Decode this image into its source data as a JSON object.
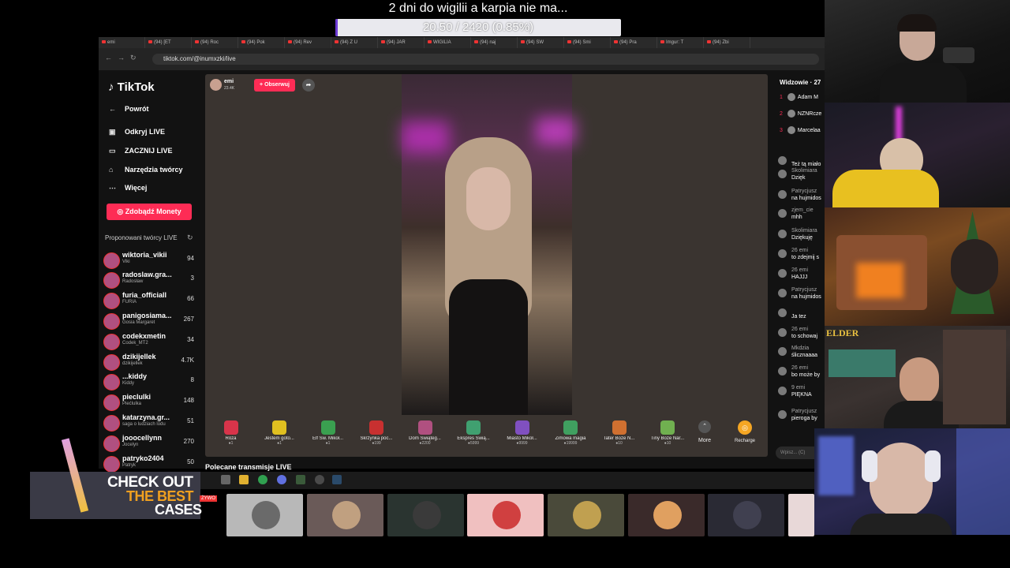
{
  "overlay": {
    "title": "2 dni do wigilii a karpia nie ma...",
    "goal_text": "20.50 / 2420 (0.85%)",
    "goal_progress": 0.0085,
    "goal_fill_color": "#6d3bd6"
  },
  "browser": {
    "tabs": [
      "emi",
      "(94) [ET",
      "(94) Roc",
      "(94) Pok",
      "(94) Rev",
      "(94) Z U",
      "(94) JAR",
      "WIGILIA",
      "(94) naj",
      "(94) SW",
      "(94) Smi",
      "(94) Pra",
      "Imgur: T",
      "(94) Zbi"
    ],
    "nav_icons": [
      "back-icon",
      "forward-icon",
      "reload-icon"
    ],
    "url": "tiktok.com/@inumxzki/live"
  },
  "sidebar": {
    "logo": "TikTok",
    "back": "Powrót",
    "items": [
      {
        "label": "Odkryj LIVE",
        "icon": "calendar-icon"
      },
      {
        "label": "ZACZNIJ LIVE",
        "icon": "video-icon"
      },
      {
        "label": "Narzędzia twórcy",
        "icon": "home-icon"
      },
      {
        "label": "Więcej",
        "icon": "dots-icon"
      }
    ],
    "coins_button": "Zdobądź Monety",
    "suggested_title": "Proponowani twórcy LIVE",
    "creators": [
      {
        "name": "wiktoria_vikii",
        "sub": "Viki",
        "count": "94"
      },
      {
        "name": "radoslaw.gra...",
        "sub": "Radosław",
        "count": "3"
      },
      {
        "name": "furia_officiall",
        "sub": "FURIA",
        "count": "66"
      },
      {
        "name": "panigosiama...",
        "sub": "Gosia Margaret",
        "count": "267"
      },
      {
        "name": "codekxmetin",
        "sub": "Codek_MT2",
        "count": "34"
      },
      {
        "name": "dzikijellek",
        "sub": "dzikijellek",
        "count": "4.7K"
      },
      {
        "name": "...kiddy",
        "sub": "Kiddy",
        "count": "8"
      },
      {
        "name": "pieclulki",
        "sub": "Piećlulka",
        "count": "148"
      },
      {
        "name": "katarzyna.gr...",
        "sub": "saga o ludziach lodu",
        "count": "51"
      },
      {
        "name": "jooocellynn",
        "sub": "Jocelyn",
        "count": "270"
      },
      {
        "name": "patryko2404",
        "sub": "Patryk",
        "count": "50"
      }
    ]
  },
  "live": {
    "host_name": "emi",
    "host_likes": "23.4K",
    "follow_label": "+ Obserwuj",
    "gifts": [
      {
        "name": "Róża",
        "price": "1",
        "color": "#d8344a"
      },
      {
        "name": "Jestem goto...",
        "price": "1",
        "color": "#e0c020"
      },
      {
        "name": "Elf Św. Mikoł...",
        "price": "1",
        "color": "#3aa050"
      },
      {
        "name": "Skrzynka poc...",
        "price": "199",
        "color": "#c83030"
      },
      {
        "name": "Dom Świąteg...",
        "price": "2200",
        "color": "#b05080"
      },
      {
        "name": "Ekspres Świą...",
        "price": "5999",
        "color": "#40a070"
      },
      {
        "name": "Miasto Mikoł...",
        "price": "9999",
        "color": "#8050c0"
      },
      {
        "name": "Zimowa magia",
        "price": "19999",
        "color": "#40a060"
      },
      {
        "name": "Tater Boże N...",
        "price": "10",
        "color": "#d07030"
      },
      {
        "name": "Tiny Boże Nar...",
        "price": "10",
        "color": "#70b050"
      }
    ],
    "more_label": "More",
    "recharge_label": "Recharge",
    "recommended": "Polecane transmisje LIVE"
  },
  "chat": {
    "viewers_title": "Widzowie · 27",
    "top_viewers": [
      {
        "rank": "1",
        "name": "Adam M"
      },
      {
        "rank": "2",
        "name": "NZNRcze"
      },
      {
        "rank": "3",
        "name": "Marcelaa"
      }
    ],
    "messages": [
      {
        "user": "",
        "text": "Też tą miało"
      },
      {
        "user": "Skolimiara",
        "text": "Dzięk"
      },
      {
        "user": "Patrycjusz",
        "text": "na hujmidos"
      },
      {
        "user": "zjem_cie",
        "text": "mhh"
      },
      {
        "user": "Skolimiara",
        "text": "Dziękuję"
      },
      {
        "user": "26 emi",
        "text": "to zdejmij s"
      },
      {
        "user": "26 emi",
        "text": "HAJJJ"
      },
      {
        "user": "Patrycjusz",
        "text": "na hujmidos"
      },
      {
        "user": "",
        "text": "Ja tez"
      },
      {
        "user": "26 emi",
        "text": "to schowaj"
      },
      {
        "user": "Mkdzia",
        "text": "ślicznaaaa"
      },
      {
        "user": "26 emi",
        "text": "bo może by"
      },
      {
        "user": "9 emi",
        "text": "PIĘKNA"
      },
      {
        "user": "Patrycjusz",
        "text": "pieroga by"
      }
    ],
    "input_placeholder": "Wpisz... (C)"
  },
  "cams": {
    "elder_tag": "ELDER"
  },
  "promo": {
    "line1": "CHECK OUT",
    "line2": "THE BEST",
    "line3": "CASES",
    "live_badge": "ŻYWO"
  },
  "thumbnails": [
    {
      "color": "#b8b8b8",
      "avatar": "#6a6a6a"
    },
    {
      "color": "#6a5a58",
      "avatar": "#c0a080"
    },
    {
      "color": "#2a3430",
      "avatar": "#3a3a3a"
    },
    {
      "color": "#f0c0c0",
      "avatar": "#d04040"
    },
    {
      "color": "#4a4a3a",
      "avatar": "#c0a050"
    },
    {
      "color": "#3a2a2a",
      "avatar": "#e0a060"
    },
    {
      "color": "#2a2a34",
      "avatar": "#404050"
    },
    {
      "color": "#e8d8d8",
      "avatar": "#c03030"
    }
  ]
}
